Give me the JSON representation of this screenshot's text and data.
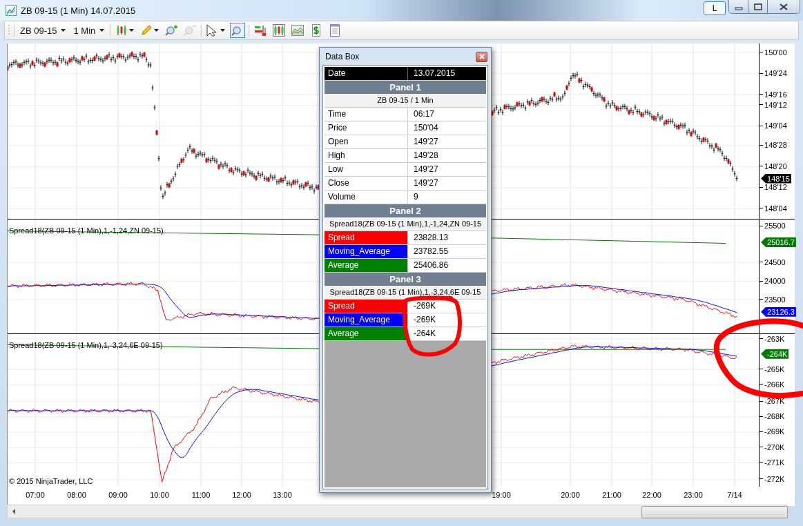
{
  "window": {
    "title": "ZB 09-15 (1 Min)  14.07.2015",
    "extra_button": "L"
  },
  "toolbar": {
    "instrument": "ZB 09-15",
    "interval": "1 Min",
    "tools": [
      {
        "kind": "candles",
        "dropdown": true,
        "disabled": false,
        "selected": false
      },
      {
        "kind": "pencil",
        "dropdown": true,
        "disabled": false,
        "selected": false
      },
      {
        "kind": "zoom-in",
        "dropdown": false,
        "disabled": false,
        "selected": false
      },
      {
        "kind": "zoom-out",
        "dropdown": false,
        "disabled": true,
        "selected": false
      },
      {
        "kind": "pointer",
        "dropdown": true,
        "disabled": false,
        "selected": false
      },
      {
        "kind": "zoom-box",
        "dropdown": false,
        "disabled": false,
        "selected": true
      },
      {
        "kind": "strategies",
        "dropdown": false,
        "disabled": false,
        "selected": false
      },
      {
        "kind": "indicators",
        "dropdown": false,
        "disabled": false,
        "selected": false
      },
      {
        "kind": "area",
        "dropdown": false,
        "disabled": false,
        "selected": false
      },
      {
        "kind": "dollar",
        "dropdown": false,
        "disabled": false,
        "selected": false
      },
      {
        "kind": "properties",
        "dropdown": false,
        "disabled": false,
        "selected": false
      }
    ]
  },
  "panels": [
    {
      "kind": "candles",
      "ticks": [
        "150'00",
        "149'24",
        "149'16",
        "149'12",
        "149'04",
        "148'28",
        "148'20",
        "148'12",
        "148'04"
      ],
      "markers": [
        {
          "text": "148'15",
          "color": "#000000"
        }
      ]
    },
    {
      "kind": "lines",
      "label": "Spread18(ZB 09-15 (1 Min),1,-1,24,ZN 09-15)",
      "ticks": [
        "25500",
        "24500",
        "24000",
        "23500"
      ],
      "markers": [
        {
          "text": "25016.7",
          "color": "#007a00"
        },
        {
          "text": "23126.3",
          "color": "#0000ff"
        }
      ]
    },
    {
      "kind": "lines",
      "label": "Spread18(ZB 09-15 (1 Min),1,-3,24,6E 09-15)",
      "ticks": [
        "-263K",
        "-265K",
        "-266K",
        "-267K",
        "-268K",
        "-269K",
        "-270K",
        "-271K",
        "-272K"
      ],
      "markers": [
        {
          "text": "-264K",
          "color": "#007a00"
        }
      ]
    }
  ],
  "copyright": "© 2015 NinjaTrader, LLC",
  "time_axis": [
    "07:00",
    "08:00",
    "09:00",
    "10:00",
    "11:00",
    "12:00",
    "13:00",
    "19:00",
    "20:00",
    "21:00",
    "22:00",
    "23:00",
    "7/14"
  ],
  "data_box": {
    "title": "Data Box",
    "date_label": "Date",
    "date_value": "13.07.2015",
    "sections": [
      {
        "title": "Panel 1",
        "subtitle": "ZB 09-15 / 1 Min",
        "rows": [
          {
            "label": "Time",
            "value": "06:17"
          },
          {
            "label": "Price",
            "value": "150'04"
          },
          {
            "label": "Open",
            "value": "149'27"
          },
          {
            "label": "High",
            "value": "149'28"
          },
          {
            "label": "Low",
            "value": "149'27"
          },
          {
            "label": "Close",
            "value": "149'27"
          },
          {
            "label": "Volume",
            "value": "9"
          }
        ]
      },
      {
        "title": "Panel 2",
        "subtitle": "Spread18(ZB 09-15 (1 Min),1,-1,24,ZN 09-15",
        "rows": [
          {
            "label": "Spread",
            "value": "23828.13",
            "color": "#ff0000"
          },
          {
            "label": "Moving_Average",
            "value": "23782.55",
            "color": "#0000ff"
          },
          {
            "label": "Average",
            "value": "25406.86",
            "color": "#008000"
          }
        ]
      },
      {
        "title": "Panel 3",
        "subtitle": "Spread18(ZB 09-15 (1 Min),1,-3,24,6E 09-15",
        "rows": [
          {
            "label": "Spread",
            "value": "-269K",
            "color": "#ff0000"
          },
          {
            "label": "Moving_Average",
            "value": "-269K",
            "color": "#0000ff"
          },
          {
            "label": "Average",
            "value": "-264K",
            "color": "#008000"
          }
        ]
      }
    ]
  }
}
